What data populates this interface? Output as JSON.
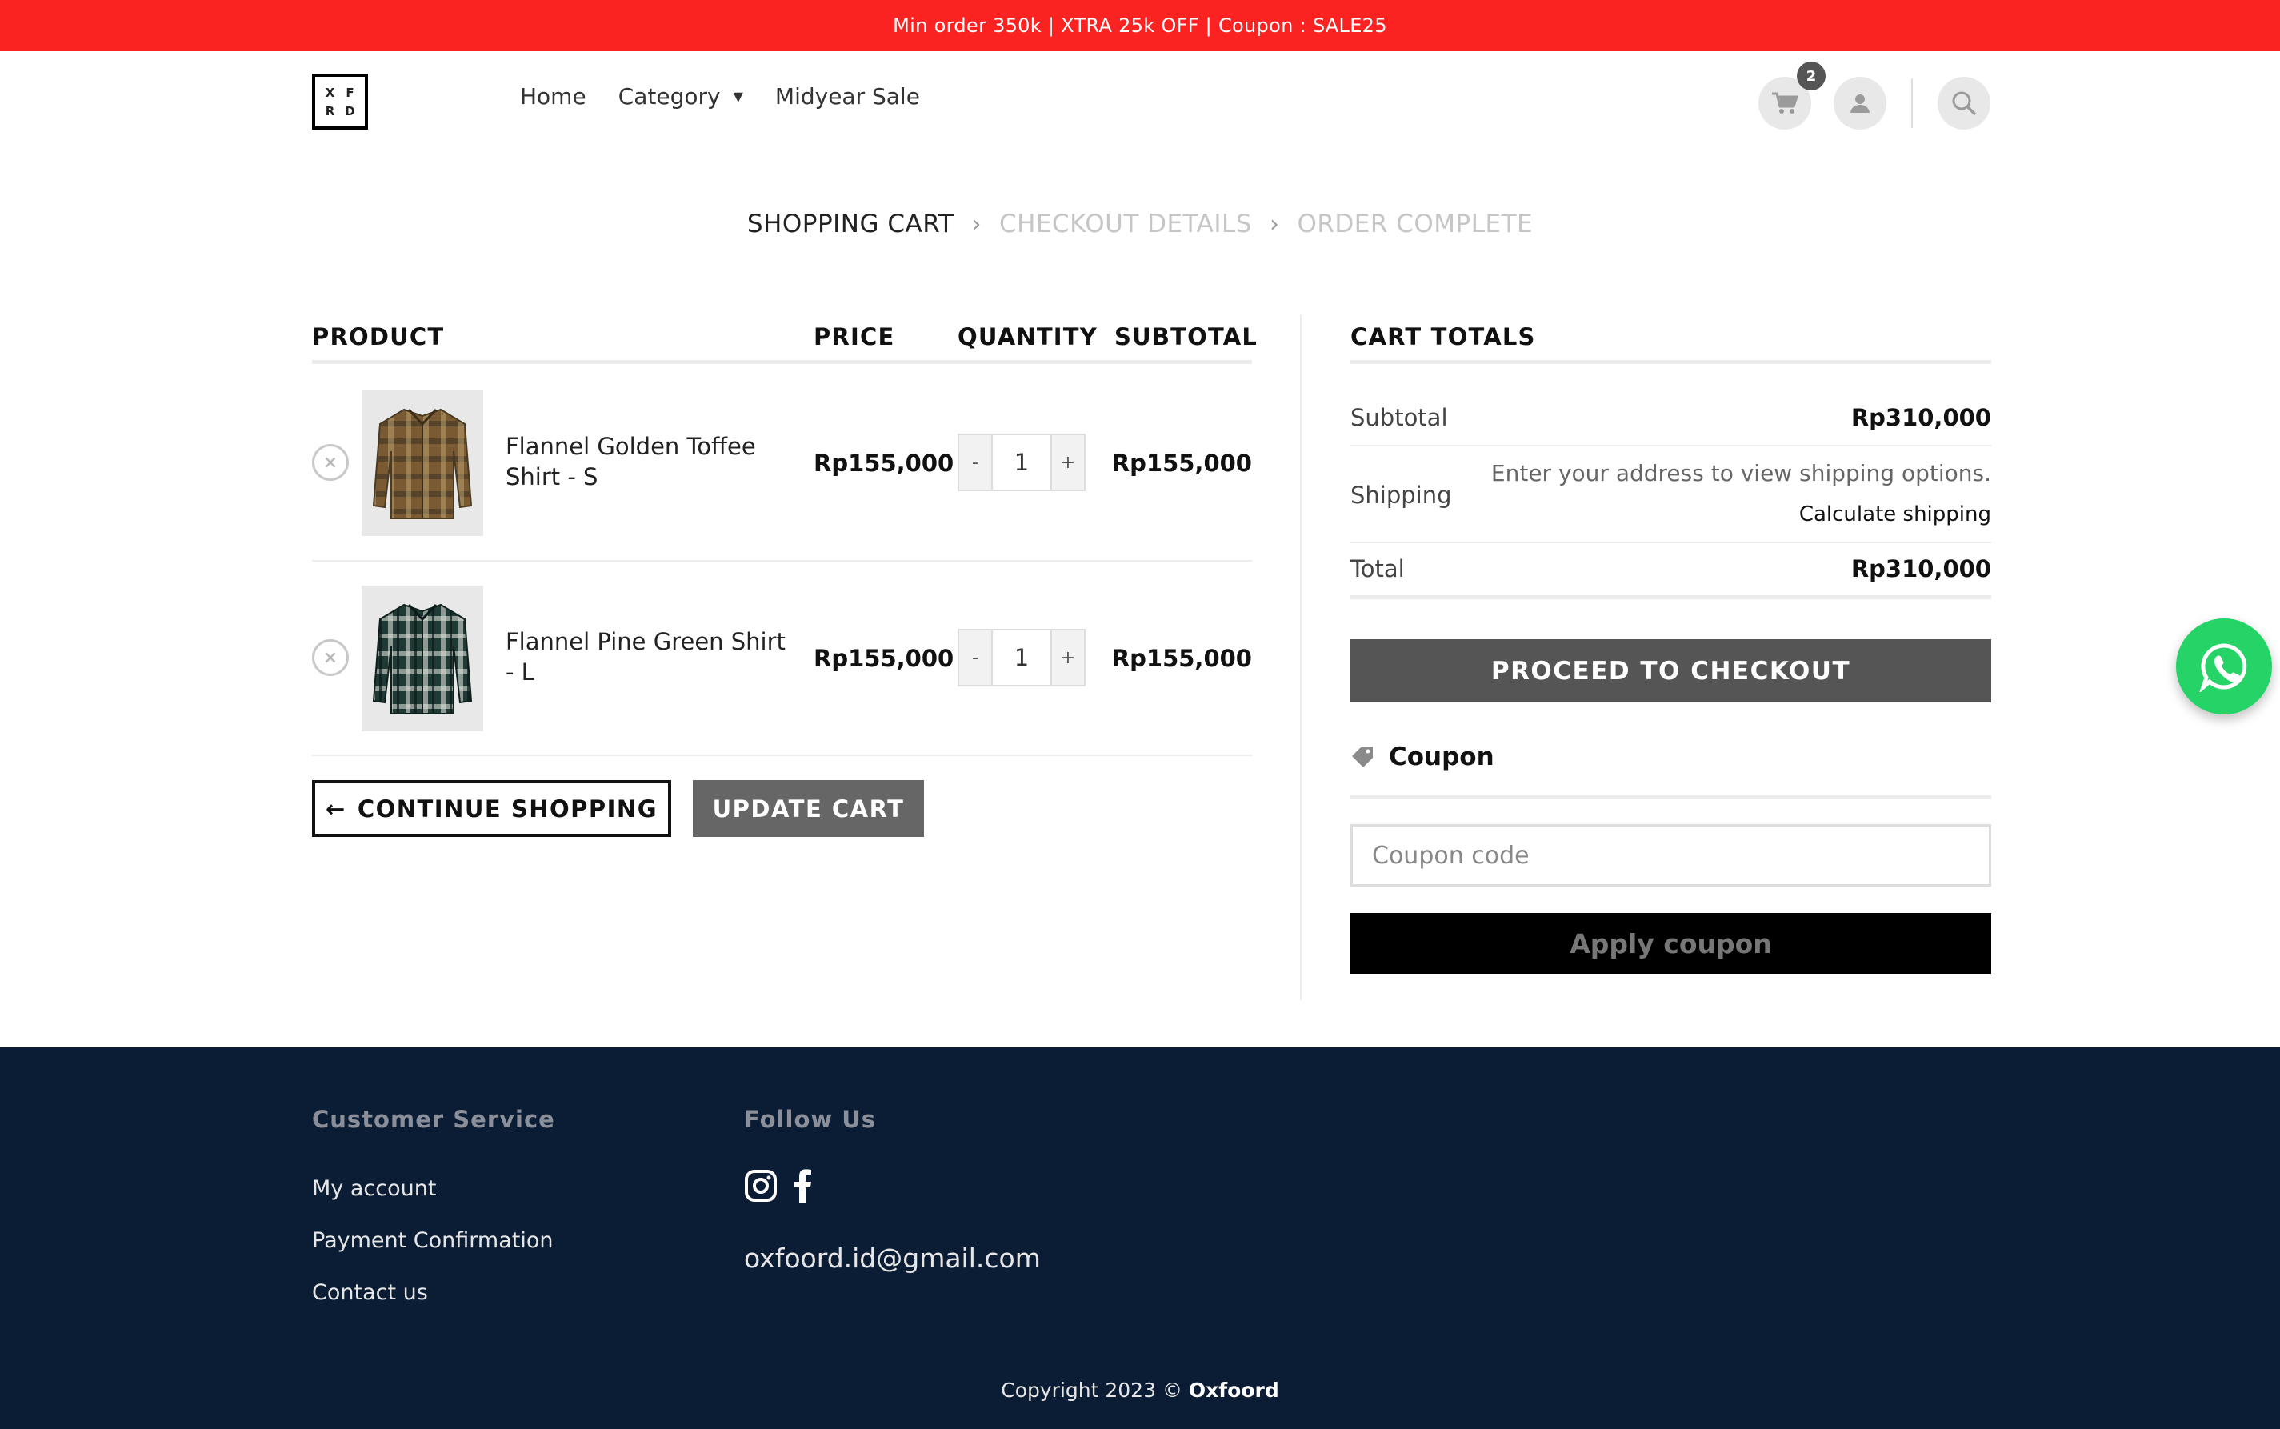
{
  "promo_bar": {
    "text": "Min order 350k | XTRA 25k OFF | Coupon : SALE25"
  },
  "header": {
    "logo": {
      "letters": [
        "X",
        "F",
        "R",
        "D"
      ]
    },
    "nav": [
      {
        "label": "Home"
      },
      {
        "label": "Category",
        "has_dropdown": true
      },
      {
        "label": "Midyear Sale"
      }
    ],
    "cart_count": "2",
    "icons": [
      "cart-icon",
      "user-icon",
      "search-icon"
    ]
  },
  "steps": [
    {
      "label": "SHOPPING CART",
      "active": true
    },
    {
      "label": "CHECKOUT DETAILS",
      "active": false
    },
    {
      "label": "ORDER COMPLETE",
      "active": false
    }
  ],
  "cart_table": {
    "headers": {
      "product": "PRODUCT",
      "price": "PRICE",
      "quantity": "QUANTITY",
      "subtotal": "SUBTOTAL"
    },
    "rows": [
      {
        "name_line1": "Flannel Golden Toffee",
        "name_line2": "Shirt - S",
        "price": "Rp155,000",
        "quantity": "1",
        "subtotal": "Rp155,000",
        "color": "#7a5a32"
      },
      {
        "name_line1": "Flannel Pine Green Shirt",
        "name_line2": "- L",
        "price": "Rp155,000",
        "quantity": "1",
        "subtotal": "Rp155,000",
        "color": "#1f3a35"
      }
    ],
    "qty_minus": "-",
    "qty_plus": "+"
  },
  "actions": {
    "continue_label": "CONTINUE SHOPPING",
    "continue_arrow": "←",
    "update_label": "UPDATE CART"
  },
  "cart_totals": {
    "title": "CART TOTALS",
    "subtotal_label": "Subtotal",
    "subtotal_value": "Rp310,000",
    "shipping_label": "Shipping",
    "shipping_info": "Enter your address to view shipping options.",
    "calculate_shipping": "Calculate shipping",
    "total_label": "Total",
    "total_value": "Rp310,000",
    "checkout_label": "PROCEED TO CHECKOUT"
  },
  "coupon": {
    "title": "Coupon",
    "placeholder": "Coupon code",
    "apply_label": "Apply coupon"
  },
  "footer": {
    "customer_service_title": "Customer Service",
    "links": [
      "My account",
      "Payment Confirmation",
      "Contact us"
    ],
    "follow_title": "Follow Us",
    "social_icons": [
      "instagram-icon",
      "facebook-icon"
    ],
    "email": "oxfoord.id@gmail.com",
    "copyright_prefix": "Copyright 2023 © ",
    "brand": "Oxfoord"
  },
  "colors": {
    "promo_red": "#fb2222",
    "footer_navy": "#0b1d35",
    "whatsapp_green": "#25d366",
    "checkout_gray": "#555555"
  }
}
